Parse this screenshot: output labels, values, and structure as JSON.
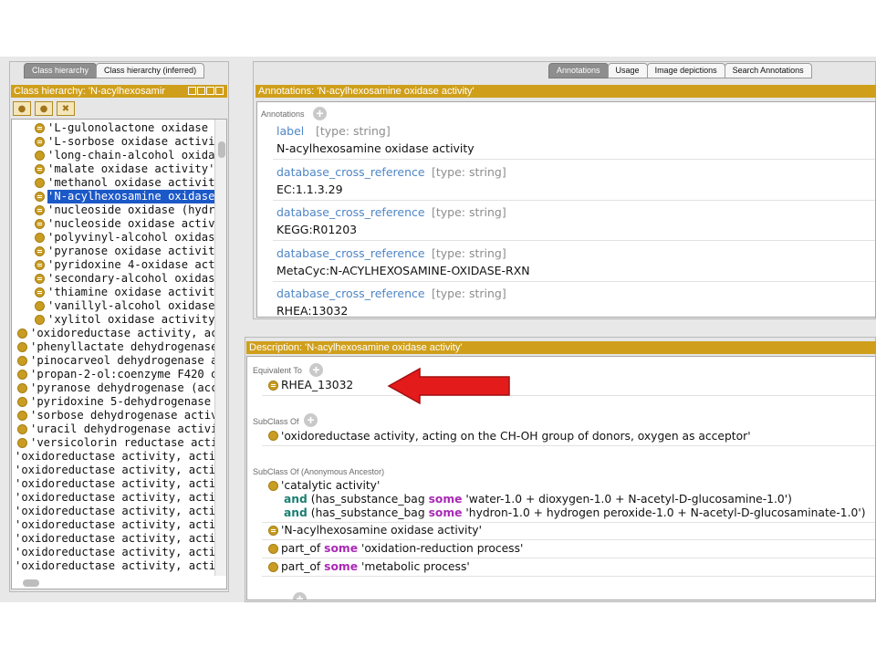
{
  "left_tabs": [
    "Class hierarchy",
    "Class hierarchy (inferred)"
  ],
  "left_title": "Class hierarchy: 'N-acylhexosamir",
  "tree": [
    {
      "text": "'L-gulonolactone oxidase activ",
      "indent": 1,
      "icon": "eq"
    },
    {
      "text": "'L-sorbose oxidase activity' = F",
      "indent": 1,
      "icon": "eq"
    },
    {
      "text": "'long-chain-alcohol oxidase a",
      "indent": 1,
      "icon": "plain"
    },
    {
      "text": "'malate oxidase activity' = RHE/",
      "indent": 1,
      "icon": "eq"
    },
    {
      "text": "'methanol oxidase activity'",
      "indent": 1,
      "icon": "plain"
    },
    {
      "text": "'N-acylhexosamine oxidase ac",
      "indent": 1,
      "icon": "eq",
      "selected": true
    },
    {
      "text": "'nucleoside oxidase (hydroger",
      "indent": 1,
      "icon": "eq"
    },
    {
      "text": "'nucleoside oxidase activity' =",
      "indent": 1,
      "icon": "eq"
    },
    {
      "text": "'polyvinyl-alcohol oxidase acti",
      "indent": 1,
      "icon": "plain"
    },
    {
      "text": "'pyranose oxidase activity' = Rl",
      "indent": 1,
      "icon": "eq"
    },
    {
      "text": "'pyridoxine 4-oxidase activity'",
      "indent": 1,
      "icon": "eq"
    },
    {
      "text": "'secondary-alcohol oxidase ac",
      "indent": 1,
      "icon": "eq"
    },
    {
      "text": "'thiamine oxidase activity' = RH",
      "indent": 1,
      "icon": "eq"
    },
    {
      "text": "'vanillyl-alcohol oxidase activi",
      "indent": 1,
      "icon": "plain"
    },
    {
      "text": "'xylitol oxidase activity'",
      "indent": 1,
      "icon": "plain"
    },
    {
      "text": "'oxidoreductase activity, acting o",
      "indent": 0,
      "icon": "plain"
    },
    {
      "text": "'phenyllactate dehydrogenase act",
      "indent": 0,
      "icon": "plain"
    },
    {
      "text": "'pinocarveol dehydrogenase activ",
      "indent": 0,
      "icon": "plain"
    },
    {
      "text": "'propan-2-ol:coenzyme F420 ox",
      "indent": 0,
      "icon": "plain"
    },
    {
      "text": "'pyranose dehydrogenase (accept",
      "indent": 0,
      "icon": "plain"
    },
    {
      "text": "'pyridoxine 5-dehydrogenase act",
      "indent": 0,
      "icon": "plain"
    },
    {
      "text": "'sorbose dehydrogenase activity'",
      "indent": 0,
      "icon": "plain"
    },
    {
      "text": "'uracil dehydrogenase activity'",
      "indent": 0,
      "icon": "plain"
    },
    {
      "text": "'versicolorin reductase activity'",
      "indent": 0,
      "icon": "plain"
    },
    {
      "text": "'oxidoreductase activity, acting on d",
      "indent": -1,
      "icon": "none"
    },
    {
      "text": "'oxidoreductase activity, acting on h",
      "indent": -1,
      "icon": "none"
    },
    {
      "text": "'oxidoreductase activity, acting on h",
      "indent": -1,
      "icon": "none"
    },
    {
      "text": "'oxidoreductase activity, acting on ir",
      "indent": -1,
      "icon": "none"
    },
    {
      "text": "'oxidoreductase activity, acting on N",
      "indent": -1,
      "icon": "none"
    },
    {
      "text": "'oxidoreductase activity, acting on o",
      "indent": -1,
      "icon": "none"
    },
    {
      "text": "'oxidoreductase activity, acting on p",
      "indent": -1,
      "icon": "none"
    },
    {
      "text": "'oxidoreductase activity, acting on p",
      "indent": -1,
      "icon": "none"
    },
    {
      "text": "'oxidoreductase activity, acting on p",
      "indent": -1,
      "icon": "none"
    }
  ],
  "right_tabs": [
    "Annotations",
    "Usage",
    "Image depictions",
    "Search Annotations"
  ],
  "annotations_title": "Annotations: 'N-acylhexosamine oxidase activity'",
  "annotations_label": "Annotations",
  "annotations": [
    {
      "property": "label",
      "type": "[type: string]",
      "value": "N-acylhexosamine oxidase activity"
    },
    {
      "property": "database_cross_reference",
      "type": "[type: string]",
      "value": "EC:1.1.3.29"
    },
    {
      "property": "database_cross_reference",
      "type": "[type: string]",
      "value": "KEGG:R01203"
    },
    {
      "property": "database_cross_reference",
      "type": "[type: string]",
      "value": "MetaCyc:N-ACYLHEXOSAMINE-OXIDASE-RXN"
    },
    {
      "property": "database_cross_reference",
      "type": "[type: string]",
      "value": "RHEA:13032"
    }
  ],
  "description_title": "Description: 'N-acylhexosamine oxidase activity'",
  "equivalent_to": {
    "label": "Equivalent To",
    "value": "RHEA_13032"
  },
  "subclass_of": {
    "label": "SubClass Of",
    "value": "'oxidoreductase activity, acting on the CH-OH group of donors, oxygen as acceptor'"
  },
  "subclass_anon": {
    "label": "SubClass Of (Anonymous Ancestor)",
    "catalytic": "'catalytic activity'",
    "kw_and": "and",
    "kw_some": "some",
    "line1_prop": "(has_substance_bag",
    "line1_filler": "'water-1.0 + dioxygen-1.0 + N-acetyl-D-glucosamine-1.0')",
    "line2_prop": "(has_substance_bag",
    "line2_filler": "'hydron-1.0 + hydrogen peroxide-1.0 + N-acetyl-D-glucosaminate-1.0')",
    "class_item": "'N-acylhexosamine oxidase activity'",
    "part_of": "part_of",
    "part1_filler": "'oxidation-reduction process'",
    "part2_filler": "'metabolic process'"
  },
  "colors": {
    "accent_gold": "#cf9f1b",
    "selection": "#1b58c8",
    "arrow": "#e41b1b",
    "property_blue": "#4f86c6",
    "keyword_and": "#1b7f73",
    "keyword_some": "#a929b5"
  }
}
